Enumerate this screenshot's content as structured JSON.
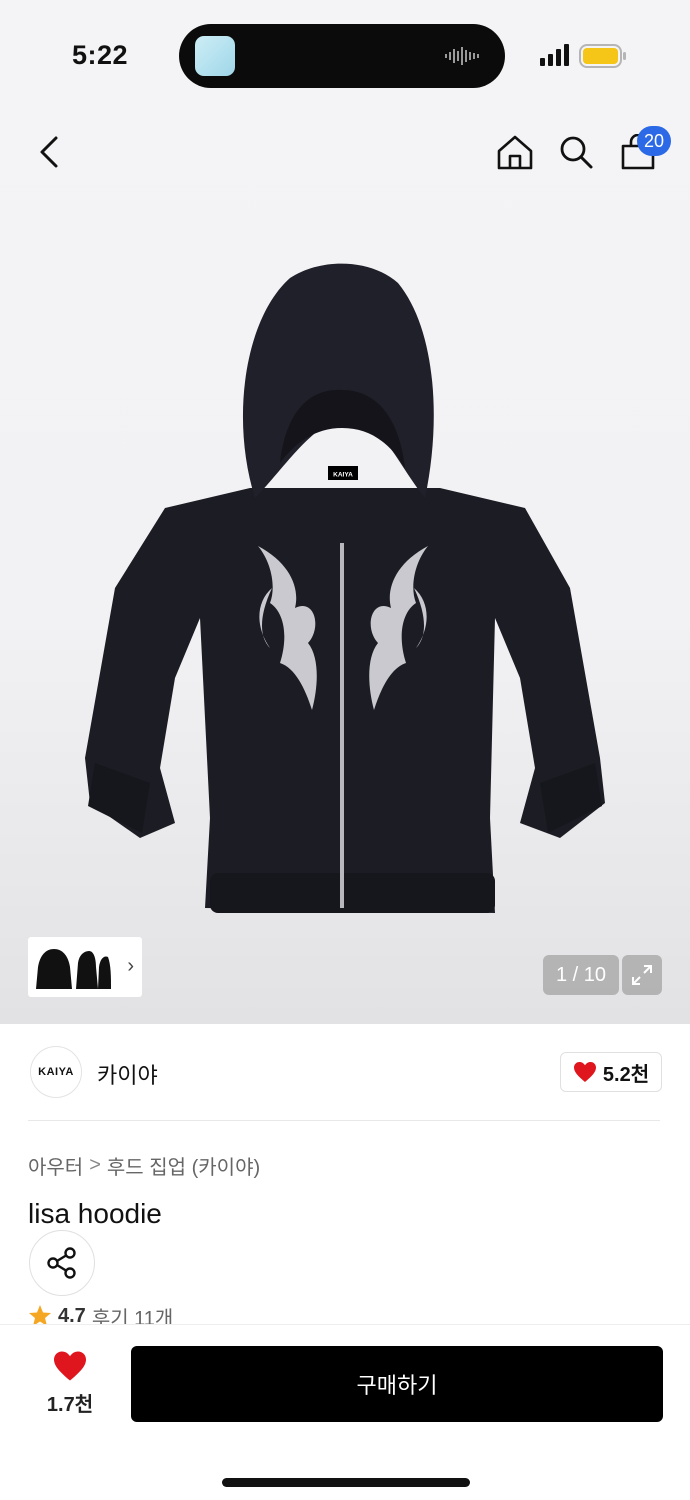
{
  "status_bar": {
    "time": "5:22",
    "battery_color": "#f5c518"
  },
  "nav": {
    "back_icon": "chevron-left-icon",
    "home_icon": "home-icon",
    "search_icon": "search-icon",
    "cart_icon": "shopping-bag-icon",
    "cart_count": "20",
    "badge_color": "#2c69e6"
  },
  "gallery": {
    "page_indicator": "1 / 10",
    "thumb_chevron": "›",
    "hoodie_logo": "KAIYA"
  },
  "brand": {
    "logo_text": "KAIYA",
    "name": "카이야",
    "likes": "5.2천",
    "heart_color": "#e0161e"
  },
  "breadcrumb": {
    "category": "아우터",
    "separator": ">",
    "subcategory": "후드 집업 (카이야)"
  },
  "product": {
    "title": "lisa hoodie",
    "rating": "4.7",
    "reviews": "후기 11개",
    "star_color": "#f5a623"
  },
  "bottom_bar": {
    "wish_count": "1.7천",
    "buy_label": "구매하기"
  }
}
